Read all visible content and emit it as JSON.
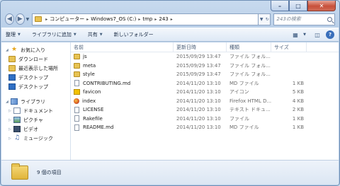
{
  "address": {
    "segments": [
      "コンピューター",
      "Windows7_OS (C:)",
      "tmp",
      "243"
    ]
  },
  "search": {
    "placeholder": "243の検索"
  },
  "toolbar": {
    "organize": "整理",
    "add_to_library": "ライブラリに追加",
    "share": "共有",
    "new_folder": "新しいフォルダー"
  },
  "sidebar": {
    "favorites": {
      "label": "お気に入り",
      "items": [
        "ダウンロード",
        "最近表示した場所",
        "デスクトップ",
        "デスクトップ"
      ]
    },
    "libraries": {
      "label": "ライブラリ",
      "items": [
        "ドキュメント",
        "ピクチャ",
        "ビデオ",
        "ミュージック"
      ]
    }
  },
  "columns": {
    "name": "名前",
    "date": "更新日時",
    "type": "種類",
    "size": "サイズ"
  },
  "files": [
    {
      "name": "js",
      "date": "2015/09/29 13:47",
      "type": "ファイル フォル...",
      "size": "",
      "icon": "folder-icon"
    },
    {
      "name": "meta",
      "date": "2015/09/29 13:47",
      "type": "ファイル フォル...",
      "size": "",
      "icon": "folder-icon"
    },
    {
      "name": "style",
      "date": "2015/09/29 13:47",
      "type": "ファイル フォル...",
      "size": "",
      "icon": "folder-icon"
    },
    {
      "name": "CONTRIBUTING.md",
      "date": "2014/11/20 13:10",
      "type": "MD ファイル",
      "size": "1 KB",
      "icon": "file-icon"
    },
    {
      "name": "favicon",
      "date": "2014/11/20 13:10",
      "type": "アイコン",
      "size": "5 KB",
      "icon": "image-icon"
    },
    {
      "name": "index",
      "date": "2014/11/20 13:10",
      "type": "Firefox HTML D...",
      "size": "4 KB",
      "icon": "firefox-icon"
    },
    {
      "name": "LICENSE",
      "date": "2014/11/20 13:10",
      "type": "テキスト ドキュ...",
      "size": "2 KB",
      "icon": "file-icon"
    },
    {
      "name": "Rakefile",
      "date": "2014/11/20 13:10",
      "type": "ファイル",
      "size": "1 KB",
      "icon": "file-icon"
    },
    {
      "name": "README.md",
      "date": "2014/11/20 13:10",
      "type": "MD ファイル",
      "size": "1 KB",
      "icon": "file-icon"
    }
  ],
  "status": {
    "item_count": "9 個の項目"
  }
}
